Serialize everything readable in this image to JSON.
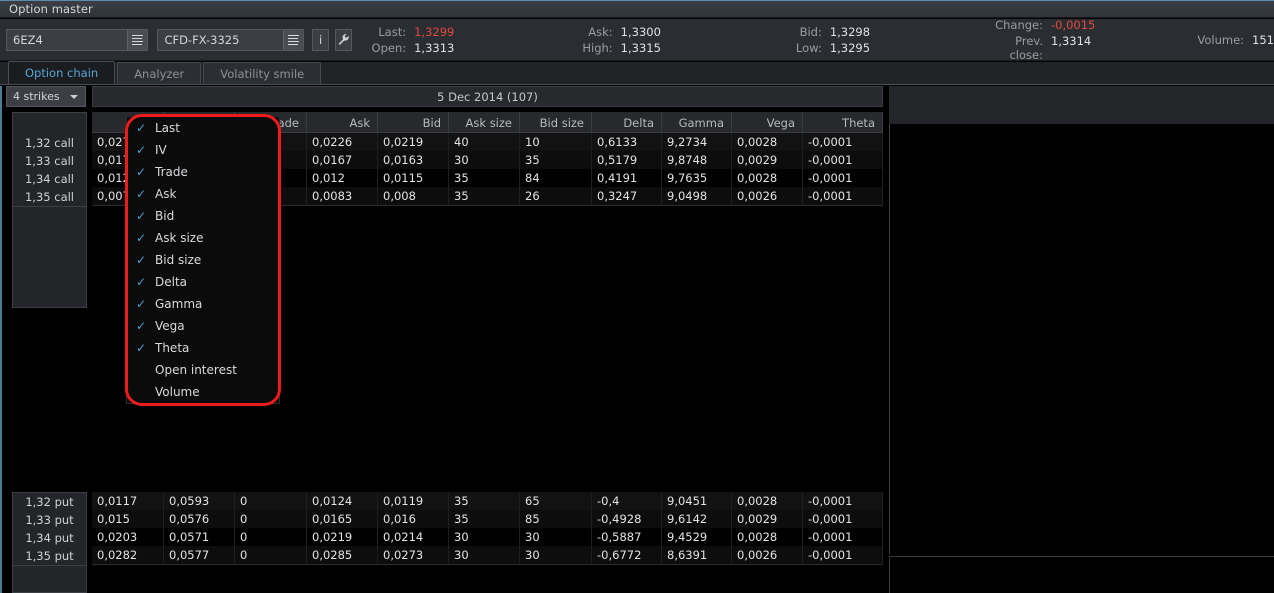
{
  "window": {
    "title": "Option master"
  },
  "toolbar": {
    "symbol": "6EZ4",
    "symbol_dropdown_icon": "list-lines-icon",
    "contract": "CFD-FX-3325",
    "contract_dropdown_icon": "list-lines-icon",
    "info_button": "i",
    "settings_icon": "wrench-icon",
    "quotes": [
      {
        "label": "Last:",
        "value": "1,3299",
        "accent": true
      },
      {
        "label": "Open:",
        "value": "1,3313",
        "accent": false
      },
      {
        "label": "Ask:",
        "value": "1,3300",
        "accent": false
      },
      {
        "label": "High:",
        "value": "1,3315",
        "accent": false
      },
      {
        "label": "Bid:",
        "value": "1,3298",
        "accent": false
      },
      {
        "label": "Low:",
        "value": "1,3295",
        "accent": false
      },
      {
        "label": "Change:",
        "value": "-0,0015",
        "accent": true
      },
      {
        "label": "Prev. close:",
        "value": "1,3314",
        "accent": false
      },
      {
        "label": "Volume:",
        "value": "151",
        "accent": false
      }
    ]
  },
  "tabs": [
    {
      "label": "Option chain",
      "active": true
    },
    {
      "label": "Analyzer",
      "active": false
    },
    {
      "label": "Volatility smile",
      "active": false
    }
  ],
  "option_chain": {
    "strikes_selector": "4 strikes",
    "expiry_header": "5 Dec 2014 (107)",
    "columns": [
      "Last",
      "IV",
      "Trade",
      "Ask",
      "Bid",
      "Ask size",
      "Bid size",
      "Delta",
      "Gamma",
      "Vega",
      "Theta"
    ],
    "calls": {
      "row_labels": [
        "1,32 call",
        "1,33 call",
        "1,34 call",
        "1,35 call"
      ],
      "rows": [
        [
          "0,027",
          "",
          "",
          "0,0226",
          "0,0219",
          "40",
          "10",
          "0,6133",
          "9,2734",
          "0,0028",
          "-0,0001"
        ],
        [
          "0,0177",
          "",
          "",
          "0,0167",
          "0,0163",
          "30",
          "35",
          "0,5179",
          "9,8748",
          "0,0029",
          "-0,0001"
        ],
        [
          "0,0124",
          "",
          "",
          "0,012",
          "0,0115",
          "35",
          "84",
          "0,4191",
          "9,7635",
          "0,0028",
          "-0,0001"
        ],
        [
          "0,0079",
          "",
          "",
          "0,0083",
          "0,008",
          "35",
          "26",
          "0,3247",
          "9,0498",
          "0,0026",
          "-0,0001"
        ]
      ]
    },
    "puts": {
      "row_labels": [
        "1,32 put",
        "1,33 put",
        "1,34 put",
        "1,35 put"
      ],
      "rows": [
        [
          "0,0117",
          "0,0593",
          "0",
          "0,0124",
          "0,0119",
          "35",
          "65",
          "-0,4",
          "9,0451",
          "0,0028",
          "-0,0001"
        ],
        [
          "0,015",
          "0,0576",
          "0",
          "0,0165",
          "0,016",
          "35",
          "85",
          "-0,4928",
          "9,6142",
          "0,0029",
          "-0,0001"
        ],
        [
          "0,0203",
          "0,0571",
          "0",
          "0,0219",
          "0,0214",
          "30",
          "30",
          "-0,5887",
          "9,4529",
          "0,0028",
          "-0,0001"
        ],
        [
          "0,0282",
          "0,0577",
          "0",
          "0,0285",
          "0,0273",
          "30",
          "30",
          "-0,6772",
          "8,6391",
          "0,0026",
          "-0,0001"
        ]
      ]
    }
  },
  "context_menu": {
    "items": [
      {
        "label": "Last",
        "checked": true
      },
      {
        "label": "IV",
        "checked": true
      },
      {
        "label": "Trade",
        "checked": true
      },
      {
        "label": "Ask",
        "checked": true
      },
      {
        "label": "Bid",
        "checked": true
      },
      {
        "label": "Ask size",
        "checked": true
      },
      {
        "label": "Bid size",
        "checked": true
      },
      {
        "label": "Delta",
        "checked": true
      },
      {
        "label": "Gamma",
        "checked": true
      },
      {
        "label": "Vega",
        "checked": true
      },
      {
        "label": "Theta",
        "checked": true
      },
      {
        "label": "Open interest",
        "checked": false
      },
      {
        "label": "Volume",
        "checked": false
      }
    ],
    "check_glyph": "✓",
    "highlight_color": "#ee1b1b"
  }
}
